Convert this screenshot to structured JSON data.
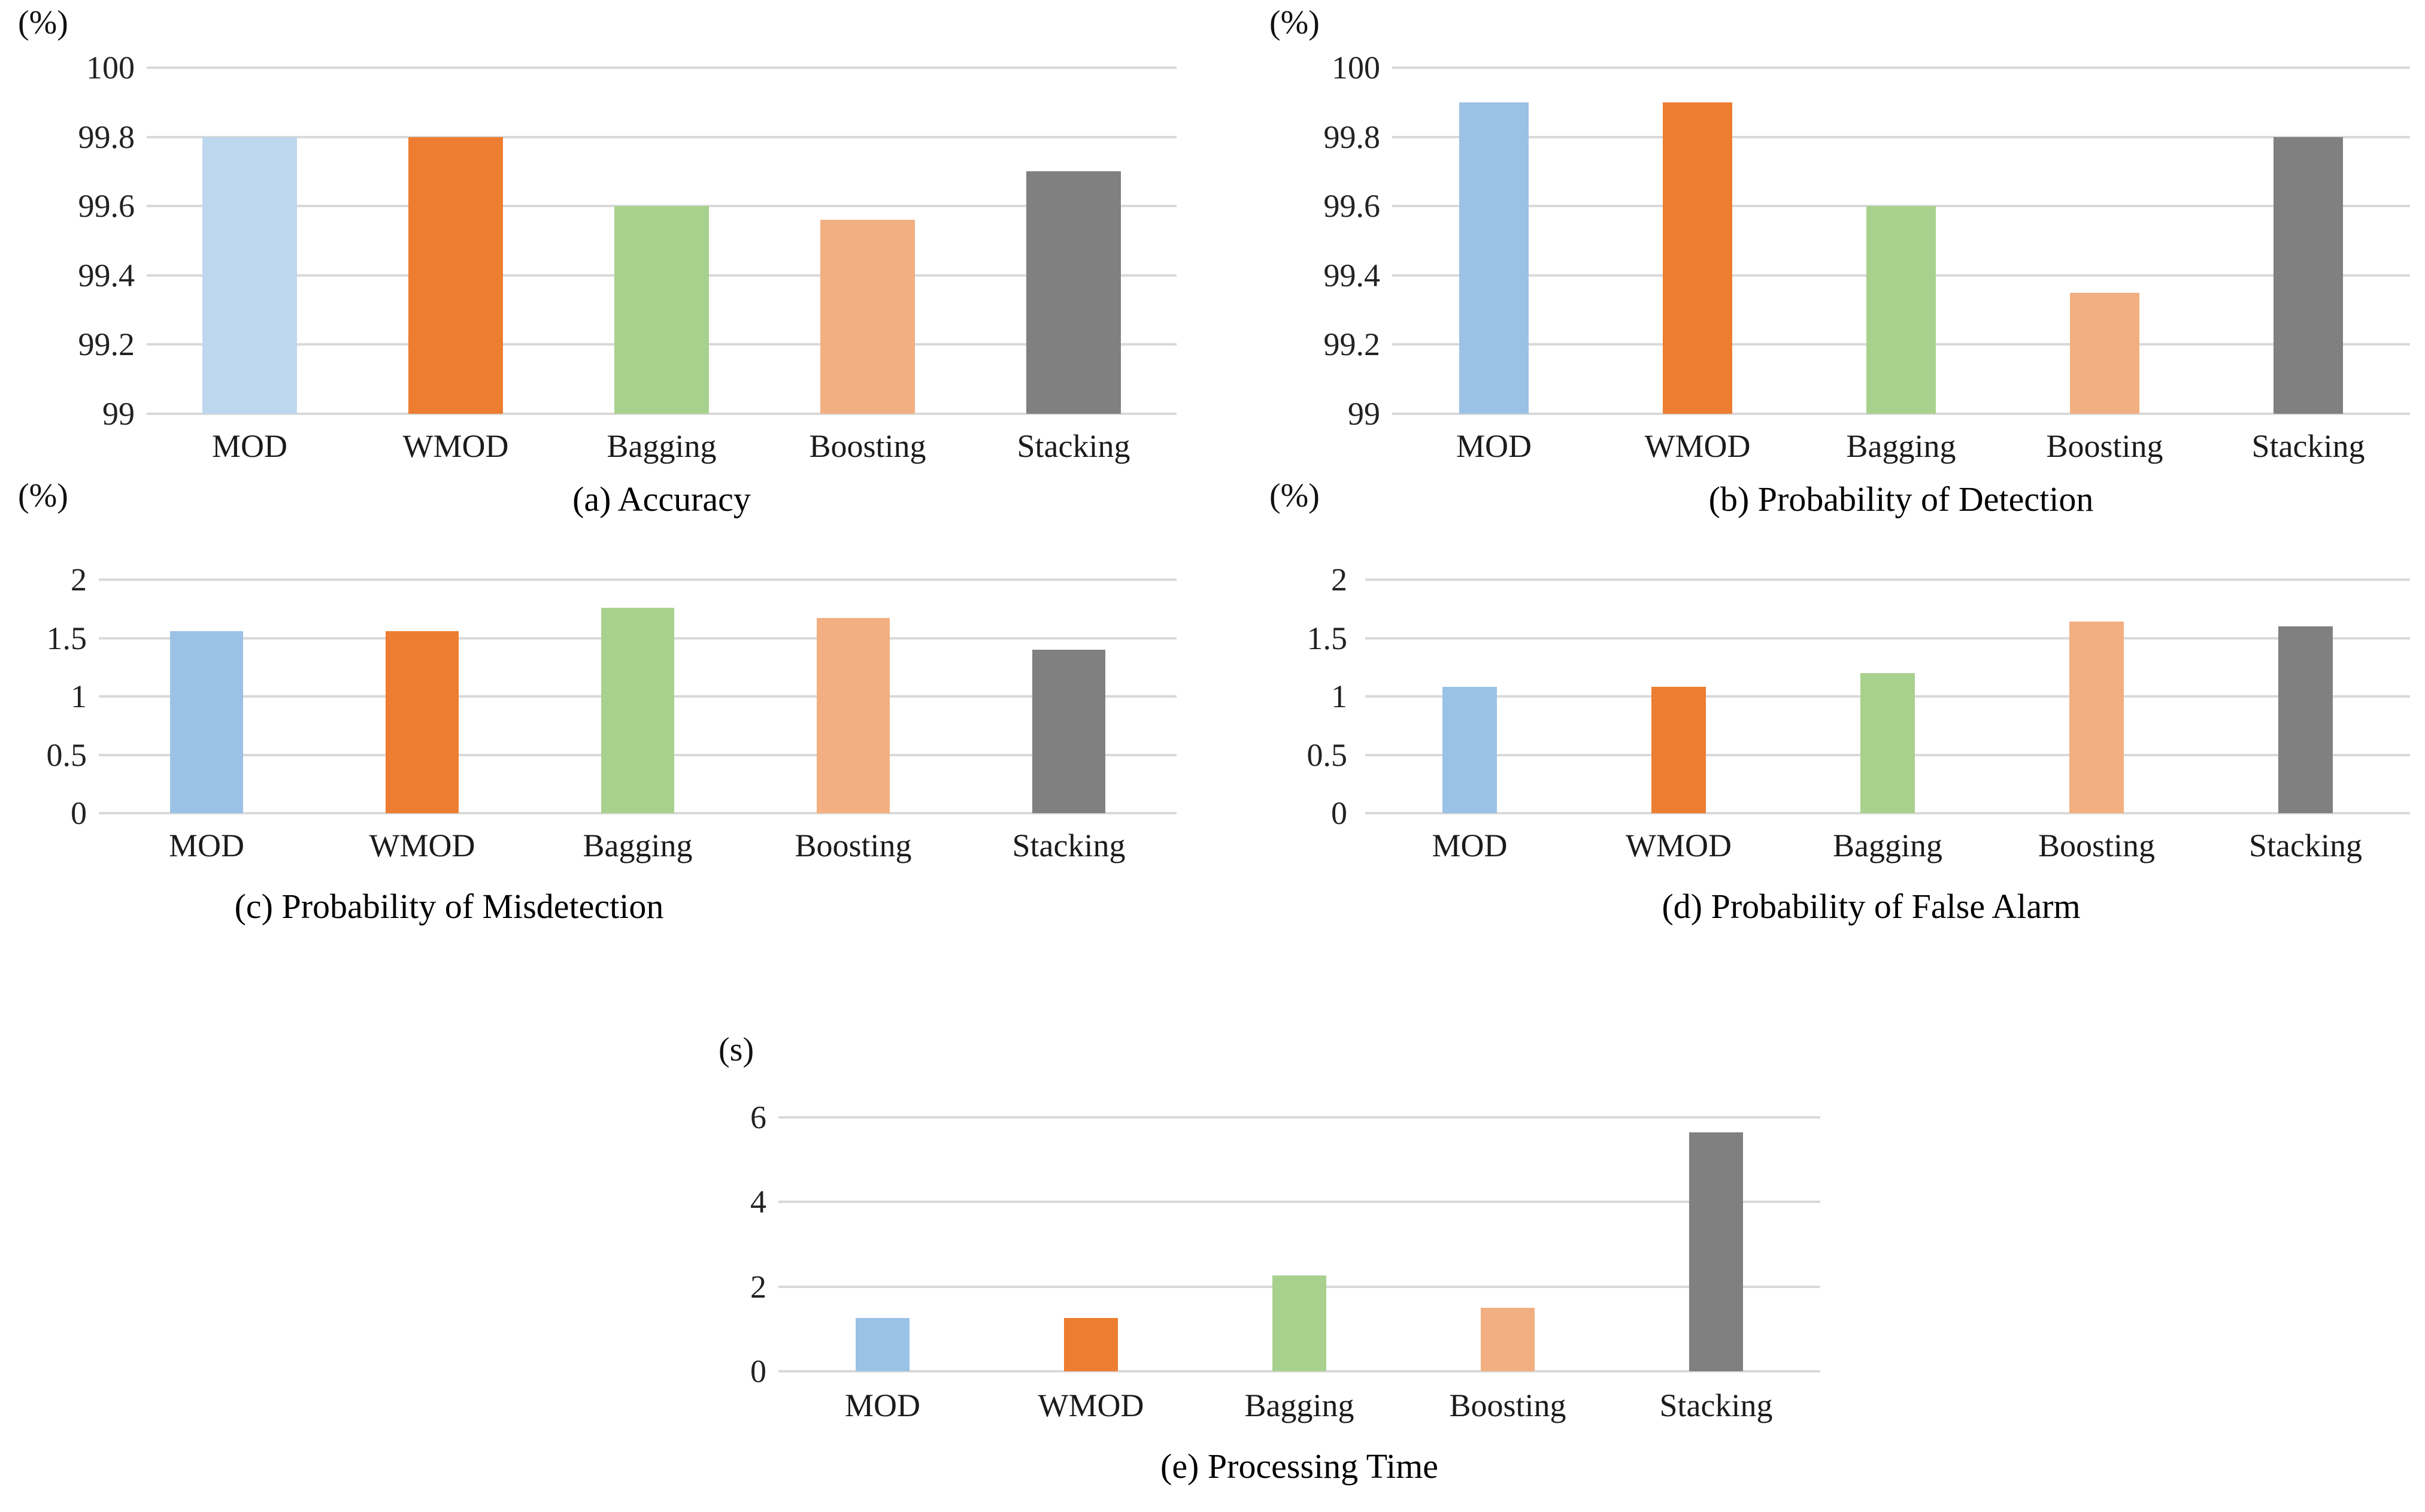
{
  "figure": {
    "palette": {
      "blue_light": "#BDD7EE",
      "blue": "#9BC2E6",
      "orange": "#ED7D31",
      "green": "#A9D18E",
      "peach": "#F2AF81",
      "gray": "#808080",
      "gridline": "#D9D9D9",
      "text": "#000000"
    }
  },
  "chart_data": [
    {
      "id": "a",
      "type": "bar",
      "title": "(a) Accuracy",
      "unit_label": "(%)",
      "xlabel": "",
      "ylabel": "",
      "categories": [
        "MOD",
        "WMOD",
        "Bagging",
        "Boosting",
        "Stacking"
      ],
      "values": [
        99.8,
        99.8,
        99.6,
        99.56,
        99.7
      ],
      "ylim": [
        99,
        100
      ],
      "yticks": [
        100,
        99.8,
        99.6,
        99.4,
        99.2,
        99
      ],
      "ytick_labels": [
        "100",
        "99.8",
        "99.6",
        "99.4",
        "99.2",
        "99"
      ],
      "bar_colors": [
        "#BDD7EE",
        "#ED7D31",
        "#A9D18E",
        "#F2AF81",
        "#808080"
      ],
      "grid": true,
      "legend": "none"
    },
    {
      "id": "b",
      "type": "bar",
      "title": "(b) Probability of Detection",
      "unit_label": "(%)",
      "xlabel": "",
      "ylabel": "",
      "categories": [
        "MOD",
        "WMOD",
        "Bagging",
        "Boosting",
        "Stacking"
      ],
      "values": [
        99.9,
        99.9,
        99.6,
        99.35,
        99.8
      ],
      "ylim": [
        99,
        100
      ],
      "yticks": [
        100,
        99.8,
        99.6,
        99.4,
        99.2,
        99
      ],
      "ytick_labels": [
        "100",
        "99.8",
        "99.6",
        "99.4",
        "99.2",
        "99"
      ],
      "bar_colors": [
        "#9BC2E6",
        "#ED7D31",
        "#A9D18E",
        "#F2AF81",
        "#808080"
      ],
      "grid": true,
      "legend": "none"
    },
    {
      "id": "c",
      "type": "bar",
      "title": "(c) Probability of Misdetection",
      "unit_label": "(%)",
      "xlabel": "",
      "ylabel": "",
      "categories": [
        "MOD",
        "WMOD",
        "Bagging",
        "Boosting",
        "Stacking"
      ],
      "values": [
        1.56,
        1.56,
        1.76,
        1.67,
        1.4
      ],
      "ylim": [
        0,
        2
      ],
      "yticks": [
        2,
        1.5,
        1,
        0.5,
        0
      ],
      "ytick_labels": [
        "2",
        "1.5",
        "1",
        "0.5",
        "0"
      ],
      "bar_colors": [
        "#9BC2E6",
        "#ED7D31",
        "#A9D18E",
        "#F2AF81",
        "#808080"
      ],
      "grid": true,
      "legend": "none"
    },
    {
      "id": "d",
      "type": "bar",
      "title": "(d) Probability of False Alarm",
      "unit_label": "(%)",
      "xlabel": "",
      "ylabel": "",
      "categories": [
        "MOD",
        "WMOD",
        "Bagging",
        "Boosting",
        "Stacking"
      ],
      "values": [
        1.08,
        1.08,
        1.2,
        1.64,
        1.6
      ],
      "ylim": [
        0,
        2
      ],
      "yticks": [
        2,
        1.5,
        1,
        0.5,
        0
      ],
      "ytick_labels": [
        "2",
        "1.5",
        "1",
        "0.5",
        "0"
      ],
      "bar_colors": [
        "#9BC2E6",
        "#ED7D31",
        "#A9D18E",
        "#F2AF81",
        "#808080"
      ],
      "grid": true,
      "legend": "none"
    },
    {
      "id": "e",
      "type": "bar",
      "title": "(e) Processing Time",
      "unit_label": "(s)",
      "xlabel": "",
      "ylabel": "",
      "categories": [
        "MOD",
        "WMOD",
        "Bagging",
        "Boosting",
        "Stacking"
      ],
      "values": [
        1.26,
        1.26,
        2.27,
        1.5,
        5.65
      ],
      "ylim": [
        0,
        6
      ],
      "yticks": [
        6,
        4,
        2,
        0
      ],
      "ytick_labels": [
        "6",
        "4",
        "2",
        "0"
      ],
      "bar_colors": [
        "#9BC2E6",
        "#ED7D31",
        "#A9D18E",
        "#F2AF81",
        "#808080"
      ],
      "grid": true,
      "legend": "none"
    }
  ]
}
